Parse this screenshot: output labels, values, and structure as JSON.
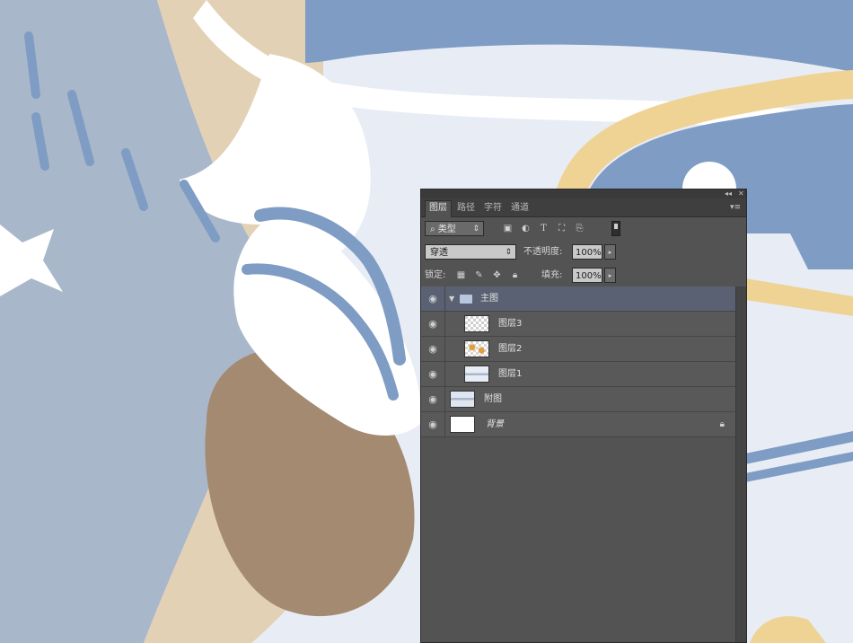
{
  "panel": {
    "tabs": [
      {
        "label": "图层",
        "active": true
      },
      {
        "label": "路径",
        "active": false
      },
      {
        "label": "字符",
        "active": false
      },
      {
        "label": "通道",
        "active": false
      }
    ],
    "collapse_glyph": "◂◂",
    "close_glyph": "✕",
    "menu_glyph": "▾≡",
    "filter": {
      "label": "类型",
      "icons": [
        "image-filter-icon",
        "adjustment-filter-icon",
        "type-filter-icon",
        "shape-filter-icon",
        "smart-object-filter-icon"
      ]
    },
    "blend": {
      "mode": "穿透",
      "opacity_label": "不透明度:",
      "opacity_value": "100%"
    },
    "lock": {
      "label": "锁定:",
      "icons": [
        "lock-transparent-icon",
        "lock-pixels-icon",
        "lock-position-icon",
        "lock-all-icon"
      ],
      "fill_label": "填充:",
      "fill_value": "100%"
    }
  },
  "layers": [
    {
      "name": "主图",
      "type": "group",
      "visible": true
    },
    {
      "name": "图层3",
      "type": "layer",
      "visible": true,
      "indent": true
    },
    {
      "name": "图层2",
      "type": "layer",
      "visible": true,
      "indent": true
    },
    {
      "name": "图层1",
      "type": "layer",
      "visible": true,
      "indent": true
    },
    {
      "name": "附图",
      "type": "layer",
      "visible": true,
      "indent": false
    },
    {
      "name": "背景",
      "type": "background",
      "visible": true,
      "locked": true
    }
  ],
  "colors": {
    "panel_bg": "#535353",
    "art_slate": "#a9b7ca",
    "art_blue": "#7f9cc4",
    "art_tan": "#e3d1b5",
    "art_brown": "#a48a71",
    "art_yellow": "#efd395",
    "art_light": "#e8edf5"
  }
}
